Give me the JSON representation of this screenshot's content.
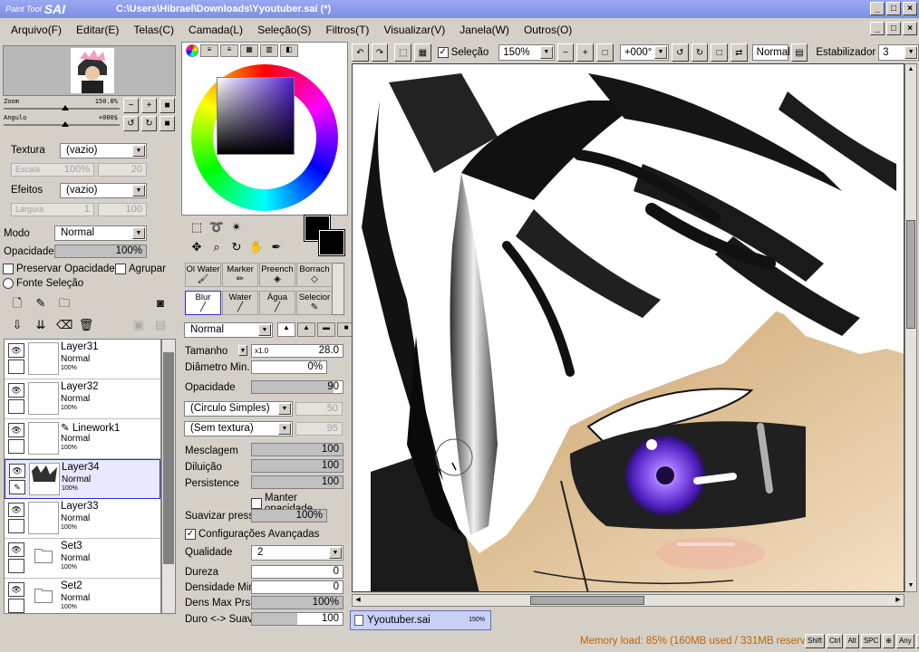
{
  "app": {
    "logo_small": "Paint Tool",
    "logo_big": "SAI",
    "title": "C:\\Users\\Hibrael\\Downloads\\Yyoutuber.sai (*)"
  },
  "menu": [
    "Arquivo(F)",
    "Editar(E)",
    "Telas(C)",
    "Camada(L)",
    "Seleção(S)",
    "Filtros(T)",
    "Visualizar(V)",
    "Janela(W)",
    "Outros(O)"
  ],
  "navigator": {
    "zoom_label": "Zoom",
    "zoom_value": "150.0%",
    "angle_label": "Angulo",
    "angle_value": "+000$"
  },
  "paper": {
    "texture_label": "Textura",
    "texture_value": "(vazio)",
    "scale_label": "Escala",
    "scale_value": "100%",
    "scale_num": "20",
    "effects_label": "Efeitos",
    "effects_value": "(vazio)",
    "width_label": "Largura",
    "width_value": "1",
    "width_num": "100"
  },
  "layer_props": {
    "mode_label": "Modo",
    "mode_value": "Normal",
    "opacity_label": "Opacidade",
    "opacity_value": "100%",
    "preserve_opacity": "Preservar Opacidade",
    "clip": "Agrupar",
    "selection_source": "Fonte Seleção"
  },
  "layers": [
    {
      "name": "Layer31",
      "mode": "Normal",
      "pct": "100%"
    },
    {
      "name": "Layer32",
      "mode": "Normal",
      "pct": "100%"
    },
    {
      "name": "Linework1",
      "mode": "Normal",
      "pct": "100%"
    },
    {
      "name": "Layer34",
      "mode": "Normal",
      "pct": "100%"
    },
    {
      "name": "Layer33",
      "mode": "Normal",
      "pct": "100%"
    },
    {
      "name": "Set3",
      "mode": "Normal",
      "pct": "100%"
    },
    {
      "name": "Set2",
      "mode": "Normal",
      "pct": "100%"
    }
  ],
  "brushes": [
    {
      "label": "Ol Water"
    },
    {
      "label": "Marker"
    },
    {
      "label": "Preench"
    },
    {
      "label": "Borrach"
    },
    {
      "label": "Blur"
    },
    {
      "label": "Water"
    },
    {
      "label": "Água"
    },
    {
      "label": "Selecior"
    }
  ],
  "brush_props": {
    "blend_mode": "Normal",
    "size_label": "Tamanho",
    "size_mult": "x1.0",
    "size_value": "28.0",
    "min_diam_label": "Diâmetro Min.",
    "min_diam_value": "0%",
    "opacity_label": "Opacidade",
    "opacity_value": "90",
    "shape": "(Circulo Simples)",
    "shape_num": "50",
    "texture": "(Sem textura)",
    "texture_num": "95",
    "blend_label": "Mesclagem",
    "blend_value": "100",
    "dilution_label": "Diluição",
    "dilution_value": "100",
    "persistence_label": "Persistence",
    "persistence_value": "100",
    "keep_opacity": "Manter opacidade",
    "smooth_label": "Suavizar pressã",
    "smooth_value": "100%",
    "advanced": "Configurações Avançadas",
    "quality_label": "Qualidade",
    "quality_value": "2",
    "hardness_label": "Dureza",
    "hardness_value": "0",
    "min_density_label": "Densidade Min.",
    "min_density_value": "0",
    "max_press_label": "Dens Max Prs.",
    "max_press_value": "100%",
    "hard_soft_label": "Duro <-> Suave",
    "hard_soft_value": "100"
  },
  "canvas_toolbar": {
    "selection_label": "Seleção",
    "zoom_value": "150%",
    "angle_value": "+000°",
    "blend_value": "Normal",
    "stabilizer_label": "Estabilizador",
    "stabilizer_value": "3"
  },
  "document_tab": {
    "name": "Yyoutuber.sai",
    "zoom": "150%"
  },
  "status": {
    "memory": "Memory load: 85% (160MB used / 331MB reserved)",
    "keys": [
      "Shift",
      "Ctrl",
      "Alt",
      "SPC",
      "⊕",
      "Any",
      "✎"
    ]
  },
  "colors": {
    "primary": "#000000",
    "secondary": "#000000",
    "accent": "#5020d0"
  }
}
